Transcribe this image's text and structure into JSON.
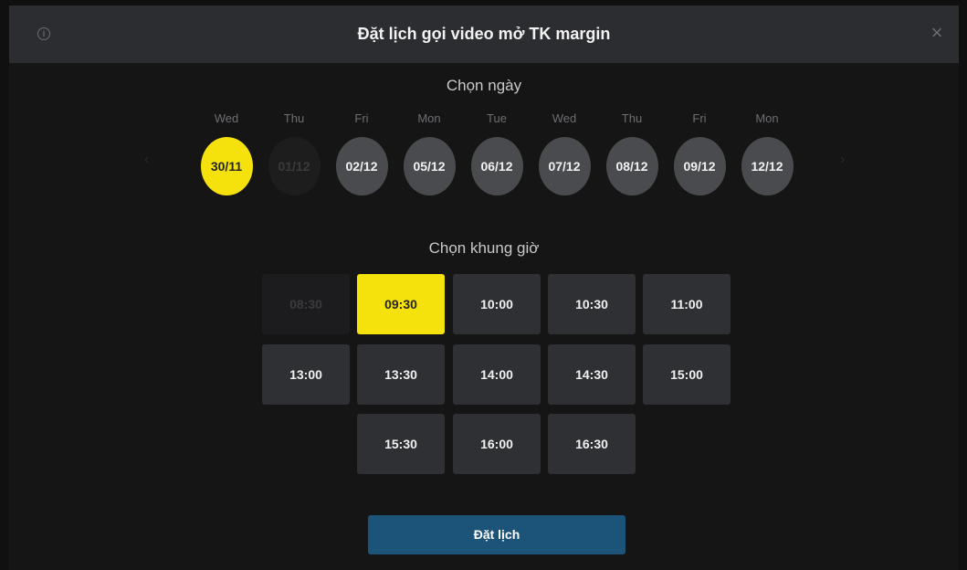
{
  "header": {
    "title": "Đặt lịch gọi video mở TK margin",
    "info_glyph": "i",
    "close_glyph": "×"
  },
  "icons": {
    "info": "info-icon",
    "close": "close-icon",
    "prev": "chevron-left-icon",
    "next": "chevron-right-icon"
  },
  "date_section": {
    "title": "Chọn ngày",
    "days": [
      {
        "weekday": "Wed",
        "date": "30/11",
        "state": "selected"
      },
      {
        "weekday": "Thu",
        "date": "01/12",
        "state": "disabled"
      },
      {
        "weekday": "Fri",
        "date": "02/12",
        "state": "available"
      },
      {
        "weekday": "Mon",
        "date": "05/12",
        "state": "available"
      },
      {
        "weekday": "Tue",
        "date": "06/12",
        "state": "available"
      },
      {
        "weekday": "Wed",
        "date": "07/12",
        "state": "available"
      },
      {
        "weekday": "Thu",
        "date": "08/12",
        "state": "available"
      },
      {
        "weekday": "Fri",
        "date": "09/12",
        "state": "available"
      },
      {
        "weekday": "Mon",
        "date": "12/12",
        "state": "available"
      }
    ]
  },
  "time_section": {
    "title": "Chọn khung giờ",
    "slots": [
      {
        "time": "08:30",
        "state": "disabled"
      },
      {
        "time": "09:30",
        "state": "selected"
      },
      {
        "time": "10:00",
        "state": "available"
      },
      {
        "time": "10:30",
        "state": "available"
      },
      {
        "time": "11:00",
        "state": "available"
      },
      {
        "time": "13:00",
        "state": "available"
      },
      {
        "time": "13:30",
        "state": "available"
      },
      {
        "time": "14:00",
        "state": "available"
      },
      {
        "time": "14:30",
        "state": "available"
      },
      {
        "time": "15:00",
        "state": "available"
      },
      {
        "time": "15:30",
        "state": "available"
      },
      {
        "time": "16:00",
        "state": "available"
      },
      {
        "time": "16:30",
        "state": "available"
      }
    ]
  },
  "book_button": {
    "label": "Đặt lịch"
  },
  "colors": {
    "selected": "#f5e10c",
    "available": "#4a4b4f",
    "slot_bg": "#2f3033",
    "button": "#1c5479",
    "header_bg": "#2c2d30"
  }
}
